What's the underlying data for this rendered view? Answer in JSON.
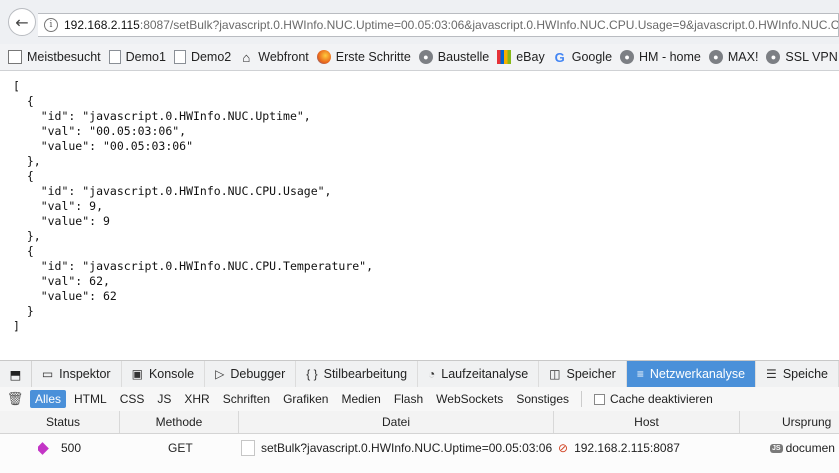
{
  "browser": {
    "url_host": "192.168.2.115",
    "url_rest": ":8087/setBulk?javascript.0.HWInfo.NUC.Uptime=00.05:03:06&javascript.0.HWInfo.NUC.CPU.Usage=9&javascript.0.HWInfo.NUC.CPU.Te"
  },
  "bookmarks": [
    {
      "label": "Meistbesucht",
      "icon": "bookmarks-icon"
    },
    {
      "label": "Demo1",
      "icon": "page-icon"
    },
    {
      "label": "Demo2",
      "icon": "page-icon"
    },
    {
      "label": "Webfront",
      "icon": "home-icon"
    },
    {
      "label": "Erste Schritte",
      "icon": "firefox-icon"
    },
    {
      "label": "Baustelle",
      "icon": "globe-icon"
    },
    {
      "label": "eBay",
      "icon": "ebay-icon"
    },
    {
      "label": "Google",
      "icon": "google-icon"
    },
    {
      "label": "HM - home",
      "icon": "globe-icon"
    },
    {
      "label": "MAX!",
      "icon": "globe-icon"
    },
    {
      "label": "SSL VPN",
      "icon": "globe-icon"
    }
  ],
  "page": {
    "json_text": "[\n  {\n    \"id\": \"javascript.0.HWInfo.NUC.Uptime\",\n    \"val\": \"00.05:03:06\",\n    \"value\": \"00.05:03:06\"\n  },\n  {\n    \"id\": \"javascript.0.HWInfo.NUC.CPU.Usage\",\n    \"val\": 9,\n    \"value\": 9\n  },\n  {\n    \"id\": \"javascript.0.HWInfo.NUC.CPU.Temperature\",\n    \"val\": 62,\n    \"value\": 62\n  }\n]"
  },
  "devtools": {
    "tabs": [
      {
        "label": "Inspektor",
        "icon": "inspector-icon",
        "glyph": "▭"
      },
      {
        "label": "Konsole",
        "icon": "console-icon",
        "glyph": "▣"
      },
      {
        "label": "Debugger",
        "icon": "debugger-icon",
        "glyph": "▷"
      },
      {
        "label": "Stilbearbeitung",
        "icon": "style-editor-icon",
        "glyph": "{ }"
      },
      {
        "label": "Laufzeitanalyse",
        "icon": "performance-icon",
        "glyph": "◔"
      },
      {
        "label": "Speicher",
        "icon": "memory-icon",
        "glyph": "◫"
      },
      {
        "label": "Netzwerkanalyse",
        "icon": "network-icon",
        "glyph": "≡"
      },
      {
        "label": "Speiche",
        "icon": "storage-icon",
        "glyph": "☰"
      }
    ],
    "active_tab": "Netzwerkanalyse",
    "filters": [
      "Alles",
      "HTML",
      "CSS",
      "JS",
      "XHR",
      "Schriften",
      "Grafiken",
      "Medien",
      "Flash",
      "WebSockets",
      "Sonstiges"
    ],
    "active_filter": "Alles",
    "cache_label": "Cache deaktivieren",
    "columns": {
      "status": "Status",
      "method": "Methode",
      "file": "Datei",
      "host": "Host",
      "origin": "Ursprung"
    },
    "request": {
      "status": "500",
      "method": "GET",
      "file": "setBulk?javascript.0.HWInfo.NUC.Uptime=00.05:03:06...",
      "host": "192.168.2.115:8087",
      "origin": "documen"
    },
    "accent_color": "#4a90d9"
  }
}
